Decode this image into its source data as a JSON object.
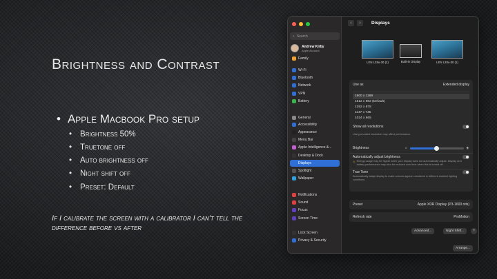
{
  "slide": {
    "title": "Brightness and Contrast",
    "main_bullet": "Apple Macbook Pro setup",
    "sub_bullets": [
      "Brightness 50%",
      "Truetone off",
      "Auto brightness off",
      "Night shift off",
      "Preset: Default"
    ],
    "note": "If I calibrate the screen with a calibrator I can't tell the difference before vs after"
  },
  "window": {
    "title": "Displays",
    "search_placeholder": "Search",
    "account": {
      "name": "Andrew Kirby",
      "sub": "Apple Account"
    },
    "sidebar": [
      {
        "label": "Family",
        "icon": "family-icon",
        "color": "#f0a030"
      },
      {
        "label": "Wi-Fi",
        "icon": "wifi-icon",
        "color": "#2f6fd6"
      },
      {
        "label": "Bluetooth",
        "icon": "bluetooth-icon",
        "color": "#2f6fd6"
      },
      {
        "label": "Network",
        "icon": "network-icon",
        "color": "#2f6fd6"
      },
      {
        "label": "VPN",
        "icon": "vpn-icon",
        "color": "#2f6fd6"
      },
      {
        "label": "Battery",
        "icon": "battery-icon",
        "color": "#3cb44b"
      },
      {
        "label": "General",
        "icon": "gear-icon",
        "color": "#888888"
      },
      {
        "label": "Accessibility",
        "icon": "accessibility-icon",
        "color": "#2f6fd6"
      },
      {
        "label": "Appearance",
        "icon": "appearance-icon",
        "color": "#222222"
      },
      {
        "label": "Menu Bar",
        "icon": "menubar-icon",
        "color": "#444444"
      },
      {
        "label": "Apple Intelligence &...",
        "icon": "intelligence-icon",
        "color": "#c060d0"
      },
      {
        "label": "Desktop & Dock",
        "icon": "dock-icon",
        "color": "#333333"
      },
      {
        "label": "Displays",
        "icon": "display-icon",
        "color": "#2f6fd6"
      },
      {
        "label": "Spotlight",
        "icon": "spotlight-icon",
        "color": "#555555"
      },
      {
        "label": "Wallpaper",
        "icon": "wallpaper-icon",
        "color": "#30a0e0"
      },
      {
        "label": "Notifications",
        "icon": "notifications-icon",
        "color": "#e04040"
      },
      {
        "label": "Sound",
        "icon": "sound-icon",
        "color": "#e04040"
      },
      {
        "label": "Focus",
        "icon": "focus-icon",
        "color": "#6040c0"
      },
      {
        "label": "Screen Time",
        "icon": "screentime-icon",
        "color": "#6040c0"
      },
      {
        "label": "Lock Screen",
        "icon": "lock-icon",
        "color": "#333333"
      },
      {
        "label": "Privacy & Security",
        "icon": "privacy-icon",
        "color": "#2f6fd6"
      }
    ],
    "selected_item": "Displays",
    "displays": [
      {
        "label": "LEN L28u-30 (2)"
      },
      {
        "label": "Built-in Display"
      },
      {
        "label": "LEN L28u-30 (1)"
      }
    ],
    "use_as": {
      "label": "Use as",
      "value": "Extended display"
    },
    "resolutions": [
      "1800 x 1169",
      "1512 x 982 (Default)",
      "1352 x 878",
      "1147 x 745",
      "1024 x 665"
    ],
    "selected_resolution": "1800 x 1169",
    "show_all_resolutions": "Show all resolutions",
    "scaled_note": "Using a scaled resolution may affect performance.",
    "brightness": {
      "label": "Brightness",
      "value": 0.5
    },
    "auto_brightness": {
      "label": "Automatically adjust brightness",
      "desc": "Energy usage may be higher when your display does not automatically adjust. Display and battery performance may also be reduced over time when this is turned off."
    },
    "true_tone": {
      "label": "True Tone",
      "desc": "Automatically adapt display to make colours appear consistent in different ambient lighting conditions."
    },
    "preset": {
      "label": "Preset",
      "value": "Apple XDR Display (P3-1600 nits)"
    },
    "refresh": {
      "label": "Refresh rate",
      "value": "ProMotion"
    },
    "buttons": {
      "advanced": "Advanced...",
      "night_shift": "Night Shift...",
      "help": "?",
      "arrange": "Arrange..."
    },
    "accent": "#2f6fd6"
  }
}
